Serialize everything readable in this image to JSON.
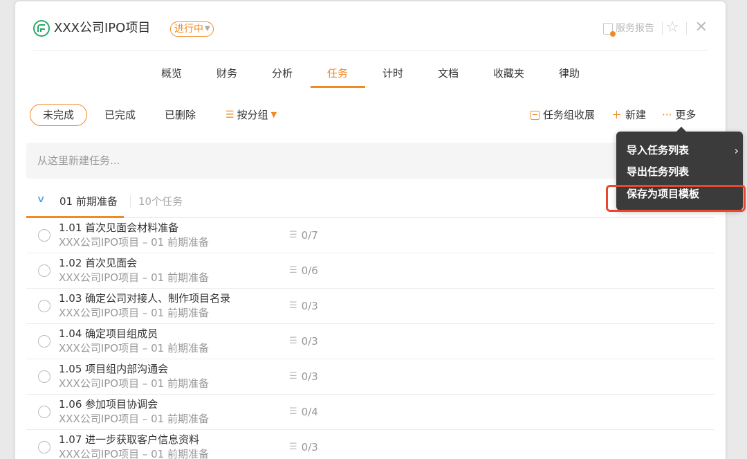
{
  "header": {
    "title": "XXX公司IPO项目",
    "status": "进行中",
    "service_report": "服务报告"
  },
  "tabs": [
    {
      "label": "概览"
    },
    {
      "label": "财务"
    },
    {
      "label": "分析"
    },
    {
      "label": "任务",
      "active": true
    },
    {
      "label": "计时"
    },
    {
      "label": "文档"
    },
    {
      "label": "收藏夹"
    },
    {
      "label": "律助"
    }
  ],
  "filters": {
    "incomplete": "未完成",
    "completed": "已完成",
    "deleted": "已删除",
    "group_by": "按分组"
  },
  "actions": {
    "collapse": "任务组收展",
    "new": "新建",
    "more": "更多"
  },
  "new_task_placeholder": "从这里新建任务...",
  "group": {
    "name": "01 前期准备",
    "count": "10个任务"
  },
  "tasks": [
    {
      "title": "1.01 首次见面会材料准备",
      "path": "XXX公司IPO项目 – 01 前期准备",
      "subtasks": "0/7"
    },
    {
      "title": "1.02 首次见面会",
      "path": "XXX公司IPO项目 – 01 前期准备",
      "subtasks": "0/6"
    },
    {
      "title": "1.03 确定公司对接人、制作项目名录",
      "path": "XXX公司IPO项目 – 01 前期准备",
      "subtasks": "0/3"
    },
    {
      "title": "1.04 确定项目组成员",
      "path": "XXX公司IPO项目 – 01 前期准备",
      "subtasks": "0/3"
    },
    {
      "title": "1.05 项目组内部沟通会",
      "path": "XXX公司IPO项目 – 01 前期准备",
      "subtasks": "0/3"
    },
    {
      "title": "1.06 参加项目协调会",
      "path": "XXX公司IPO项目 – 01 前期准备",
      "subtasks": "0/4"
    },
    {
      "title": "1.07 进一步获取客户信息资料",
      "path": "XXX公司IPO项目 – 01 前期准备",
      "subtasks": "0/3"
    }
  ],
  "more_menu": {
    "items": [
      "导入任务列表",
      "导出任务列表",
      "保存为项目模板"
    ],
    "highlighted": "保存为项目模板"
  },
  "colors": {
    "accent": "#f08a24",
    "highlight": "#e8482b",
    "menu_bg": "#3b3b3b"
  }
}
